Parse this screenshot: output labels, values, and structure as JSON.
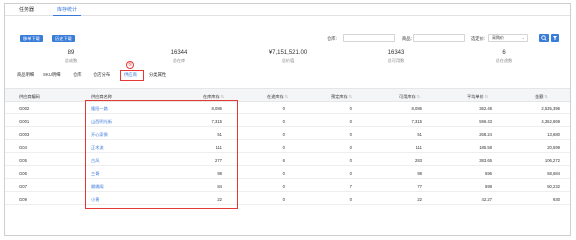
{
  "tabs": [
    "任务器",
    "库存统计"
  ],
  "toolbar": {
    "export_label": "移单下载",
    "history_label": "历史下载"
  },
  "filters": {
    "warehouse_label": "仓库:",
    "product_label": "商品:",
    "selected_label": "选定价:",
    "selected_value": "采购价"
  },
  "stats": [
    {
      "value": "89",
      "label": "总成数"
    },
    {
      "value": "16344",
      "label": "总在库"
    },
    {
      "value": "¥7,151,521.00",
      "label": "总价值"
    },
    {
      "value": "16343",
      "label": "总可用数"
    },
    {
      "value": "6",
      "label": "总在途数"
    }
  ],
  "subtabs": [
    "商品明细",
    "SKU明细",
    "仓库",
    "仓店分布",
    "供应商",
    "分类属性"
  ],
  "annotation_number": "⑤",
  "table": {
    "headers": [
      "供应商编码",
      "供应商名称",
      "在库库存",
      "在途库存",
      "预定库存",
      "可用库存",
      "平均单价",
      "金额"
    ],
    "rows": [
      [
        "G002",
        "隆阳一路",
        "8,086",
        "0",
        "0",
        "8,086",
        "362.48",
        "2,535,396"
      ],
      [
        "G001",
        "山西明光街",
        "7,315",
        "0",
        "0",
        "7,315",
        "596.43",
        "4,362,869"
      ],
      [
        "G003",
        "开心家俱",
        "51",
        "0",
        "0",
        "51",
        "268.24",
        "13,680"
      ],
      [
        "G04",
        "正木流",
        "111",
        "0",
        "0",
        "111",
        "185.58",
        "20,599"
      ],
      [
        "G05",
        "古风",
        "277",
        "6",
        "0",
        "283",
        "383.65",
        "106,272"
      ],
      [
        "G06",
        "三哥",
        "98",
        "0",
        "0",
        "98",
        "596",
        "58,684"
      ],
      [
        "G07",
        "娜娜阁",
        "84",
        "0",
        "7",
        "77",
        "598",
        "50,232"
      ],
      [
        "G09",
        "小黄",
        "22",
        "0",
        "0",
        "22",
        "42.27",
        "930"
      ]
    ]
  },
  "colors": {
    "accent": "#3a78d8",
    "highlight": "#e53935"
  }
}
